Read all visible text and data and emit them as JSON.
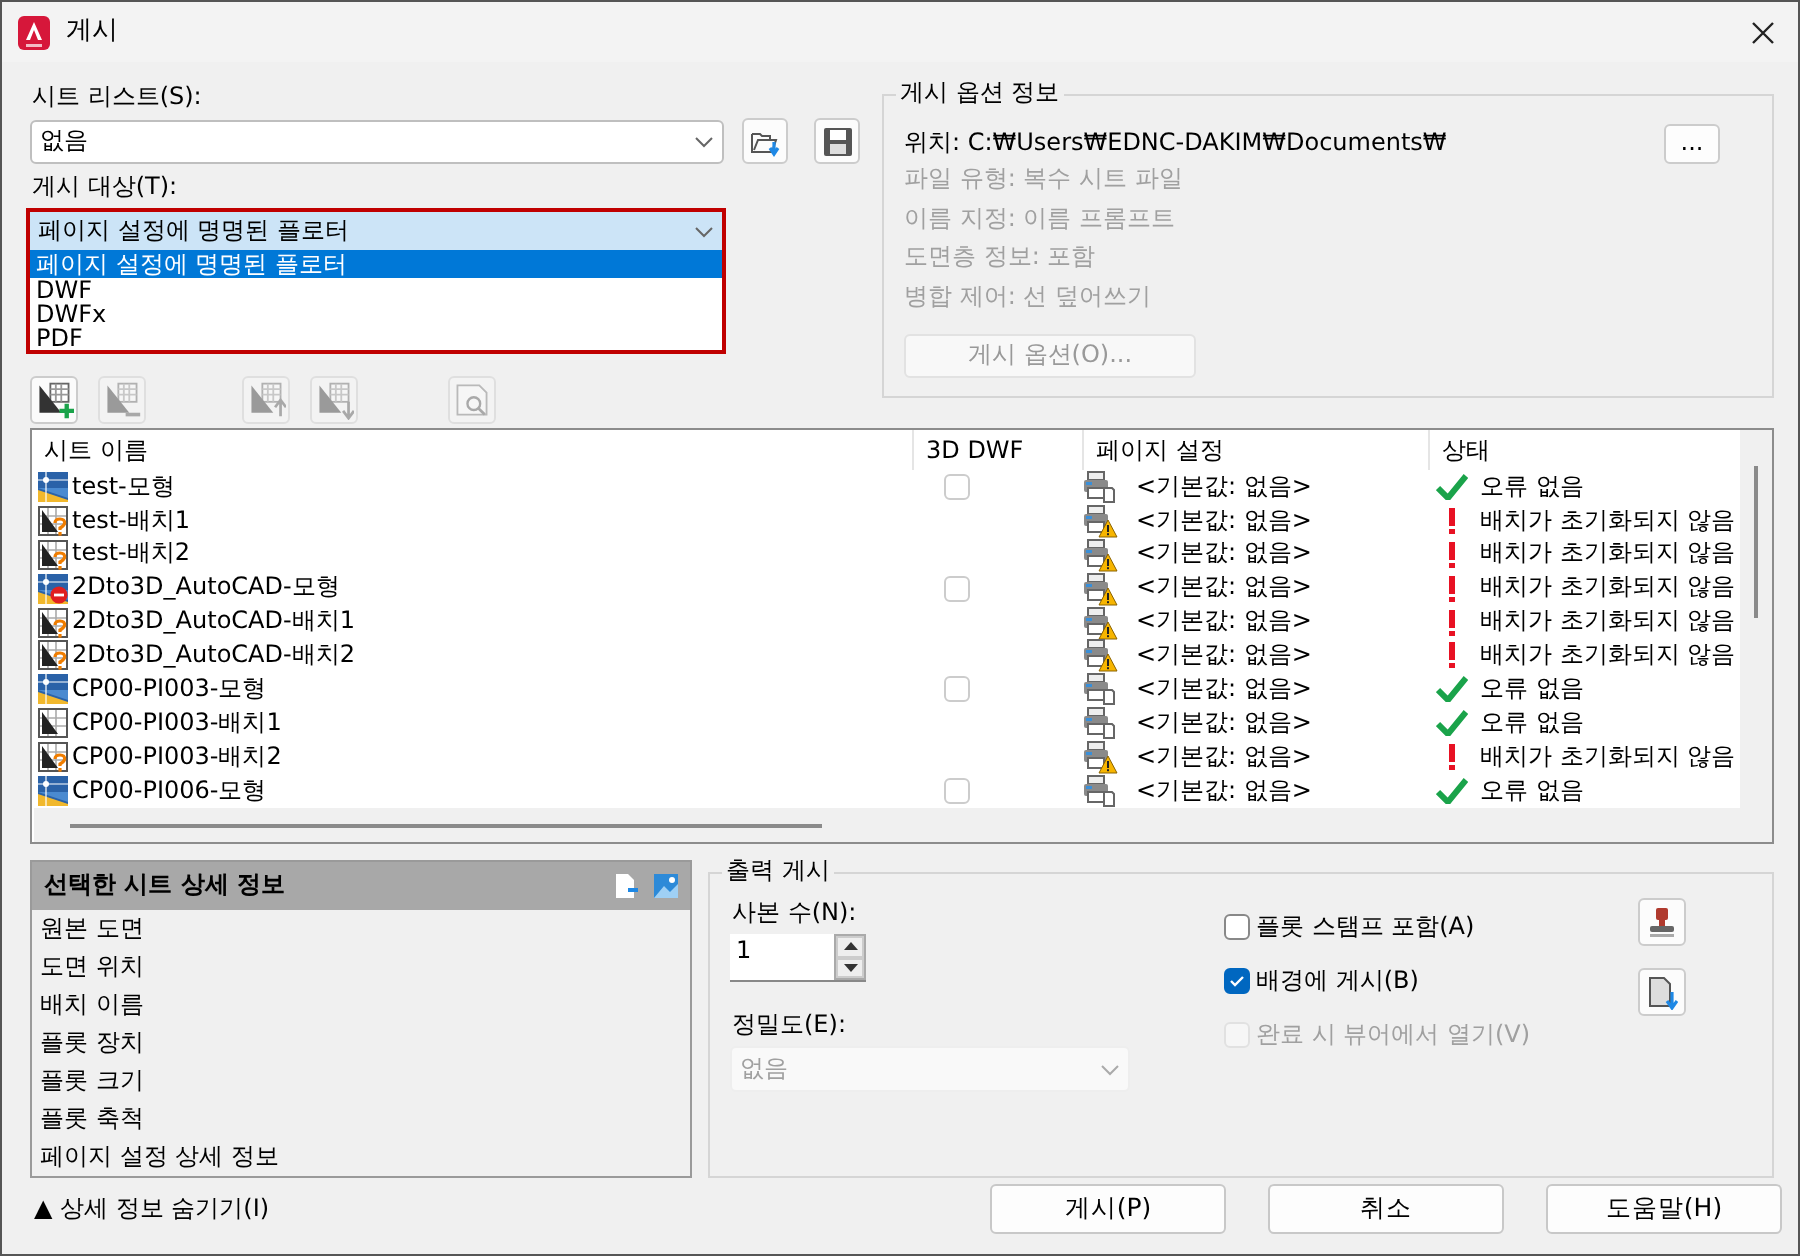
{
  "window": {
    "title": "게시"
  },
  "sheet_list": {
    "label": "시트 리스트(S):",
    "value": "없음"
  },
  "publish_to": {
    "label": "게시 대상(T):",
    "value": "페이지 설정에 명명된 플로터",
    "expanded": true,
    "options": [
      {
        "label": "페이지 설정에 명명된 플로터",
        "selected": true
      },
      {
        "label": "DWF",
        "selected": false
      },
      {
        "label": "DWFx",
        "selected": false
      },
      {
        "label": "PDF",
        "selected": false
      }
    ]
  },
  "toolbar": [
    {
      "kind": "add",
      "disabled": false
    },
    {
      "kind": "remove",
      "disabled": true
    },
    {
      "kind": "up",
      "disabled": true
    },
    {
      "kind": "down",
      "disabled": true
    },
    {
      "kind": "preview",
      "disabled": true
    }
  ],
  "options_info": {
    "title": "게시 옵션 정보",
    "location": "위치: C:₩Users₩EDNC-DAKIM₩Documents₩",
    "browse_button": "...",
    "lines": [
      "파일 유형: 복수 시트 파일",
      "이름 지정: 이름 프롬프트",
      "도면층 정보: 포함",
      "병합 제어: 선 덮어쓰기"
    ],
    "options_button": {
      "label": "게시 옵션(O)...",
      "disabled": true
    }
  },
  "sheets": {
    "columns": [
      "시트 이름",
      "3D DWF",
      "페이지 설정",
      "상태"
    ],
    "rows": [
      {
        "name": "test-모형",
        "kind": "model",
        "dwf_3d": {
          "checked": false
        },
        "page_setup": {
          "kind": "ok",
          "text": "<기본값: 없음>"
        },
        "status": {
          "kind": "ok",
          "text": "오류 없음"
        }
      },
      {
        "name": "test-배치1",
        "kind": "layout-unknown",
        "page_setup": {
          "kind": "warning",
          "text": "<기본값: 없음>"
        },
        "status": {
          "kind": "error",
          "text": "배치가 초기화되지 않음"
        }
      },
      {
        "name": "test-배치2",
        "kind": "layout-unknown",
        "page_setup": {
          "kind": "warning",
          "text": "<기본값: 없음>"
        },
        "status": {
          "kind": "error",
          "text": "배치가 초기화되지 않음"
        }
      },
      {
        "name": "2Dto3D_AutoCAD-모형",
        "kind": "model-blocked",
        "dwf_3d": {
          "checked": false
        },
        "page_setup": {
          "kind": "warning",
          "text": "<기본값: 없음>"
        },
        "status": {
          "kind": "error",
          "text": "배치가 초기화되지 않음"
        }
      },
      {
        "name": "2Dto3D_AutoCAD-배치1",
        "kind": "layout-unknown",
        "page_setup": {
          "kind": "warning",
          "text": "<기본값: 없음>"
        },
        "status": {
          "kind": "error",
          "text": "배치가 초기화되지 않음"
        }
      },
      {
        "name": "2Dto3D_AutoCAD-배치2",
        "kind": "layout-unknown",
        "page_setup": {
          "kind": "warning",
          "text": "<기본값: 없음>"
        },
        "status": {
          "kind": "error",
          "text": "배치가 초기화되지 않음"
        }
      },
      {
        "name": "CP00-PI003-모형",
        "kind": "model",
        "dwf_3d": {
          "checked": false
        },
        "page_setup": {
          "kind": "ok",
          "text": "<기본값: 없음>"
        },
        "status": {
          "kind": "ok",
          "text": "오류 없음"
        }
      },
      {
        "name": "CP00-PI003-배치1",
        "kind": "layout",
        "page_setup": {
          "kind": "ok",
          "text": "<기본값: 없음>"
        },
        "status": {
          "kind": "ok",
          "text": "오류 없음"
        }
      },
      {
        "name": "CP00-PI003-배치2",
        "kind": "layout-unknown",
        "page_setup": {
          "kind": "warning",
          "text": "<기본값: 없음>"
        },
        "status": {
          "kind": "error",
          "text": "배치가 초기화되지 않음"
        }
      },
      {
        "name": "CP00-PI006-모형",
        "kind": "model",
        "dwf_3d": {
          "checked": false
        },
        "page_setup": {
          "kind": "ok",
          "text": "<기본값: 없음>"
        },
        "status": {
          "kind": "ok",
          "text": "오류 없음"
        }
      }
    ]
  },
  "details": {
    "title": "선택한 시트 상세 정보",
    "rows": [
      "원본 도면",
      "도면 위치",
      "배치 이름",
      "플롯 장치",
      "플롯 크기",
      "플롯 축척",
      "페이지 설정 상세 정보"
    ]
  },
  "output": {
    "title": "출력 게시",
    "copies_label": "사본 수(N):",
    "copies": "1",
    "precision_label": "정밀도(E):",
    "precision": "없음",
    "precision_disabled": true,
    "checks": [
      {
        "label": "플롯 스탬프 포함(A)",
        "checked": false,
        "disabled": false
      },
      {
        "label": "배경에 게시(B)",
        "checked": true,
        "disabled": false
      },
      {
        "label": "완료 시 뷰어에서 열기(V)",
        "checked": false,
        "disabled": true
      }
    ]
  },
  "hide_details": "▲ 상세 정보 숨기기(I)",
  "buttons": [
    "게시(P)",
    "취소",
    "도움말(H)"
  ]
}
